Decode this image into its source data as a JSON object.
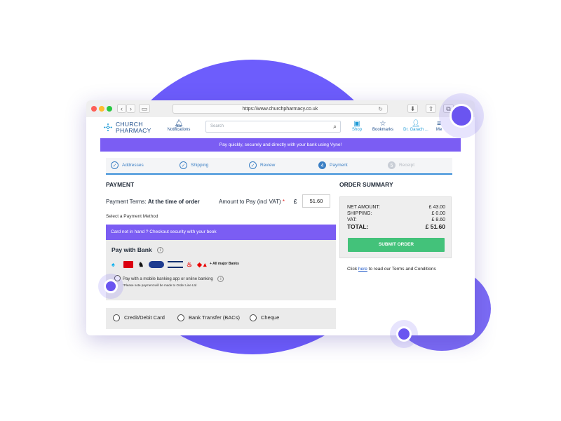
{
  "browser": {
    "url": "https://www.churchpharmacy.co.uk"
  },
  "header": {
    "logo_line1": "CHURCH",
    "logo_line2": "PHARMACY",
    "notifications": "Notifications",
    "search_placeholder": "Search",
    "shop": "Shop",
    "bookmarks": "Bookmarks",
    "user": "Dr. Garach ...",
    "menu": "Me"
  },
  "promo": "Pay quickly, securely and directly with your bank using Vyne!",
  "steps": [
    {
      "num": "✓",
      "label": "Addresses"
    },
    {
      "num": "✓",
      "label": "Shipping"
    },
    {
      "num": "✓",
      "label": "Review"
    },
    {
      "num": "4",
      "label": "Payment"
    },
    {
      "num": "5",
      "label": "Receipt"
    }
  ],
  "payment": {
    "title": "PAYMENT",
    "terms_label": "Payment Terms:",
    "terms_value": "At the time of order",
    "amount_label": "Amount to Pay (incl VAT)",
    "required_mark": "*",
    "currency": "£",
    "amount": "51.60",
    "select_label": "Select a Payment Method",
    "card_banner": "Card not in hand ? Checkout security with your book",
    "bank_title": "Pay with Bank",
    "info": "i",
    "banks": [
      "Barclays",
      "HSBC",
      "Lloyds",
      "TSB",
      "Nationwide",
      "Santander",
      "NatWest"
    ],
    "all_banks": "+ All major Banks",
    "mobile_option": "Pay with a mobile banking app or online banking",
    "note": "*Please note payment will be made to Order Line Ltd",
    "methods": [
      "Credit/Debit Card",
      "Bank Transfer (BACs)",
      "Cheque"
    ]
  },
  "summary": {
    "title": "ORDER SUMMARY",
    "net_label": "NET AMOUNT:",
    "net_value": "£ 43.00",
    "shipping_label": "SHIPPING:",
    "shipping_value": "£ 0.00",
    "vat_label": "VAT:",
    "vat_value": "£ 8.60",
    "total_label": "TOTAL:",
    "total_value": "£ 51.60",
    "submit": "SUBMIT ORDER",
    "terms_pre": "Click",
    "terms_link": "here",
    "terms_post": "to read our Terms and Conditions"
  },
  "colors": {
    "accent": "#7b5df3",
    "step_blue": "#3b7fc4",
    "submit_green": "#43c27a"
  }
}
